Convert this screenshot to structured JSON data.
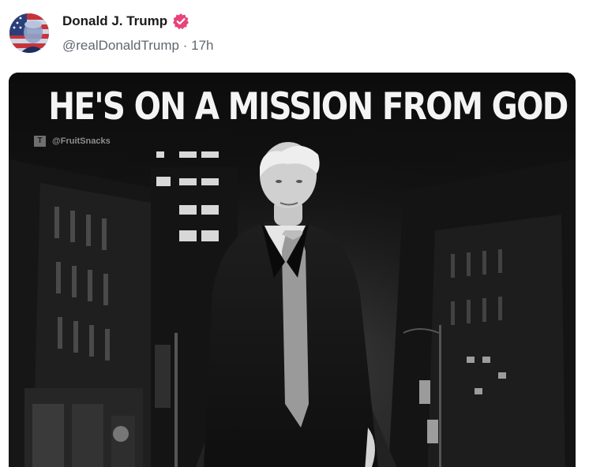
{
  "post": {
    "author_name": "Donald J. Trump",
    "handle": "@realDonaldTrump",
    "separator": "·",
    "time_ago": "17h",
    "verified_icon": "verified-badge-icon",
    "avatar_icon": "profile-avatar"
  },
  "media": {
    "headline": "HE'S ON A MISSION FROM GOD",
    "watermark": "@FruitSnacks",
    "watermark_logo": "T",
    "scene": "man-in-overcoat-walking-city-street-at-night"
  },
  "colors": {
    "verified_badge": "#e8437a",
    "handle_gray": "#606770",
    "name_black": "#1a1a1a"
  }
}
